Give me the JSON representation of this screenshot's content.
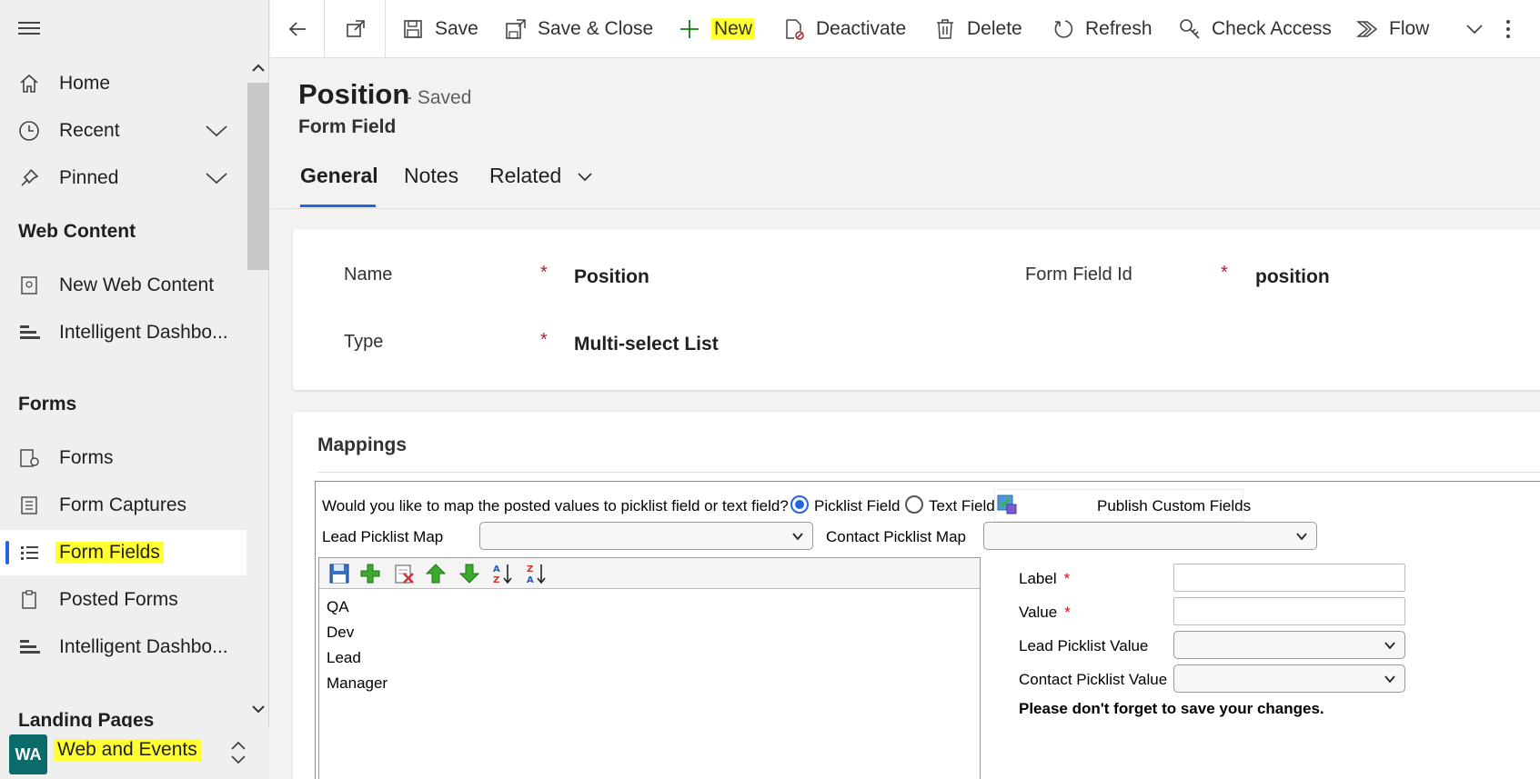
{
  "sidebar": {
    "home": "Home",
    "recent": "Recent",
    "pinned": "Pinned",
    "section_web": "Web Content",
    "new_web_content": "New Web Content",
    "intelligent_dash_1": "Intelligent Dashbo...",
    "section_forms": "Forms",
    "forms": "Forms",
    "form_captures": "Form Captures",
    "form_fields": "Form Fields",
    "posted_forms": "Posted Forms",
    "intelligent_dash_2": "Intelligent Dashbo...",
    "section_landing": "Landing Pages",
    "area_initials": "WA",
    "area_name": "Web and Events"
  },
  "toolbar": {
    "save": "Save",
    "save_close": "Save & Close",
    "new": "New",
    "deactivate": "Deactivate",
    "delete": "Delete",
    "refresh": "Refresh",
    "check_access": "Check Access",
    "flow": "Flow"
  },
  "header": {
    "title": "Position",
    "status": "- Saved",
    "entity": "Form Field"
  },
  "tabs": [
    {
      "label": "General"
    },
    {
      "label": "Notes"
    },
    {
      "label": "Related"
    }
  ],
  "general": {
    "name_label": "Name",
    "name_value": "Position",
    "id_label": "Form Field Id",
    "id_value": "position",
    "type_label": "Type",
    "type_value": "Multi-select List",
    "required_mark": "*"
  },
  "mappings": {
    "title": "Mappings",
    "question": "Would you like to map the posted values to picklist field or text field?",
    "picklist_option": "Picklist Field",
    "text_option": "Text Field",
    "publish": "Publish Custom Fields",
    "lead_map_label": "Lead Picklist Map",
    "contact_map_label": "Contact Picklist Map",
    "options": [
      "QA",
      "Dev",
      "Lead",
      "Manager"
    ],
    "label_label": "Label",
    "value_label": "Value",
    "lead_value_label": "Lead Picklist Value",
    "contact_value_label": "Contact Picklist Value",
    "note": "Please don't forget to save your changes."
  },
  "colors": {
    "accent": "#2266e3",
    "highlight": "#ffff32",
    "required": "#a4262c",
    "avatar": "#0b6a6a"
  }
}
